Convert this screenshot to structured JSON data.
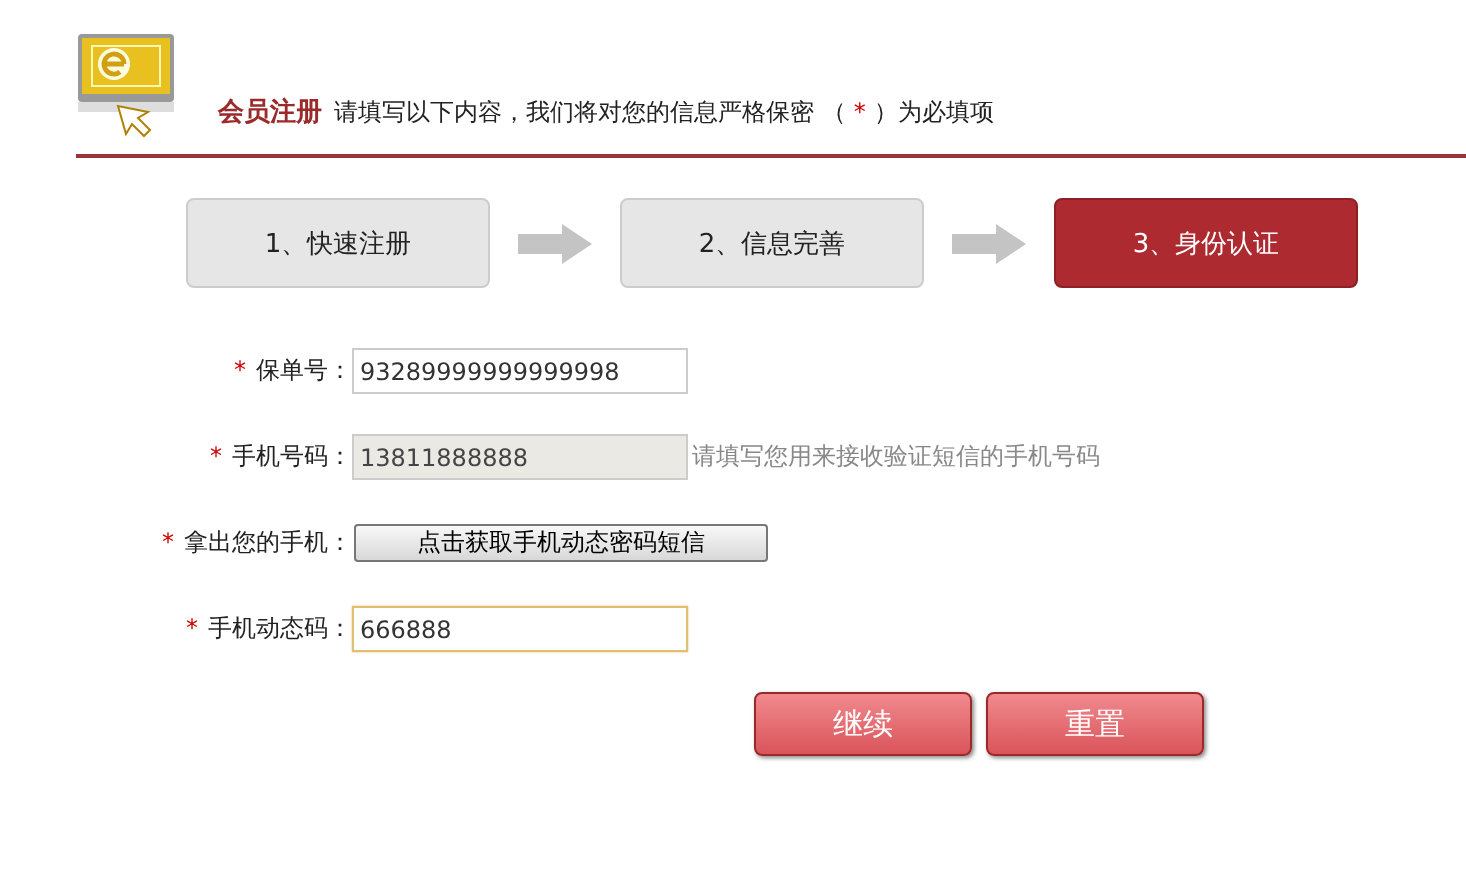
{
  "header": {
    "title": "会员注册",
    "notice_before": "请填写以下内容，我们将对您的信息严格保密 （",
    "required_mark": "*",
    "notice_after": "）为必填项"
  },
  "steps": [
    {
      "label": "1、快速注册",
      "selected": false
    },
    {
      "label": "2、信息完善",
      "selected": false
    },
    {
      "label": "3、身份认证",
      "selected": true
    }
  ],
  "fields": [
    {
      "kind": "text",
      "required": true,
      "label": "保单号：",
      "value": "93289999999999998",
      "disabled": false,
      "focused": false
    },
    {
      "kind": "text",
      "required": true,
      "label": "手机号码：",
      "value": "13811888888",
      "disabled": true,
      "focused": false,
      "hint": "请填写您用来接收验证短信的手机号码"
    },
    {
      "kind": "button",
      "required": true,
      "label": "拿出您的手机：",
      "value": "点击获取手机动态密码短信"
    },
    {
      "kind": "text",
      "required": true,
      "label": "手机动态码：",
      "value": "666888",
      "disabled": false,
      "focused": true
    }
  ],
  "buttons": [
    "继续",
    "重置"
  ]
}
